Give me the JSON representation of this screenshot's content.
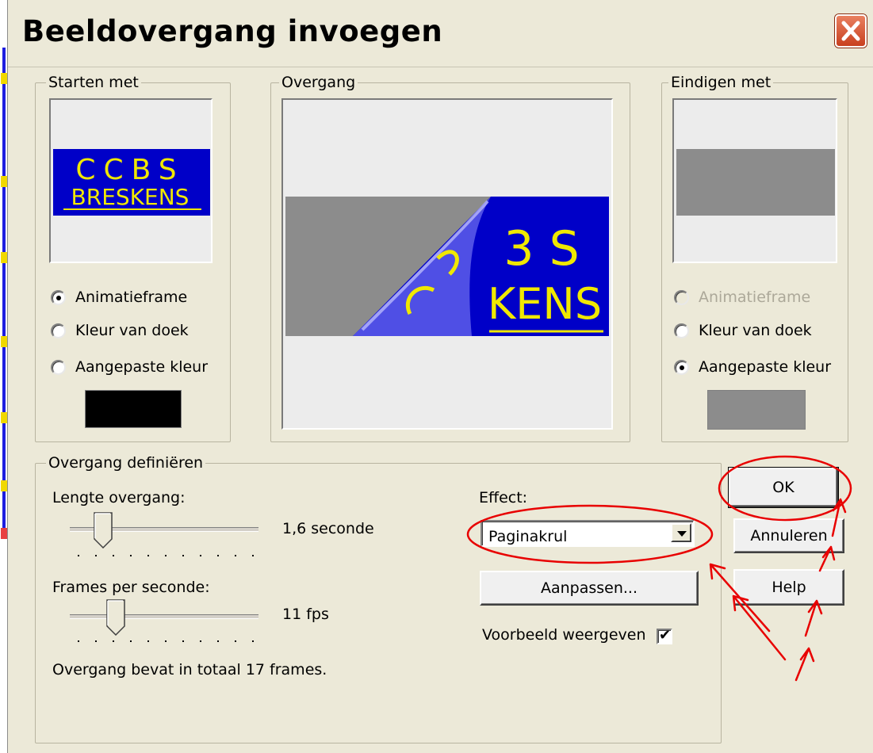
{
  "window": {
    "title": "Beeldovergang invoegen"
  },
  "start_group": {
    "label": "Starten met",
    "preview_text_line1": "CCBS",
    "preview_text_line2": "BRESKENS",
    "options": [
      {
        "label": "Animatieframe",
        "selected": true,
        "enabled": true
      },
      {
        "label": "Kleur van doek",
        "selected": false,
        "enabled": true
      },
      {
        "label": "Aangepaste kleur",
        "selected": false,
        "enabled": true
      }
    ],
    "custom_color": "#000000"
  },
  "transition_group": {
    "label": "Overgang",
    "preview_text_line1": "3 S",
    "preview_text_line2": "KENS"
  },
  "end_group": {
    "label": "Eindigen met",
    "options": [
      {
        "label": "Animatieframe",
        "selected": false,
        "enabled": false
      },
      {
        "label": "Kleur van doek",
        "selected": false,
        "enabled": true
      },
      {
        "label": "Aangepaste kleur",
        "selected": true,
        "enabled": true
      }
    ],
    "custom_color": "#808080"
  },
  "define_group": {
    "label": "Overgang definiëren",
    "length_label": "Lengte overgang:",
    "length_value": "1,6 seconde",
    "fps_label": "Frames per seconde:",
    "fps_value": "11 fps",
    "summary": "Overgang bevat in totaal 17 frames.",
    "effect_label": "Effect:",
    "effect_value": "Paginakrul",
    "customize_button": "Aanpassen...",
    "preview_checkbox_label": "Voorbeeld weergeven",
    "preview_checked": true
  },
  "buttons": {
    "ok": "OK",
    "cancel": "Annuleren",
    "help": "Help"
  },
  "colors": {
    "preview_blue": "#0000c8",
    "preview_text": "#f0e800",
    "annotation_red": "#e80000"
  }
}
